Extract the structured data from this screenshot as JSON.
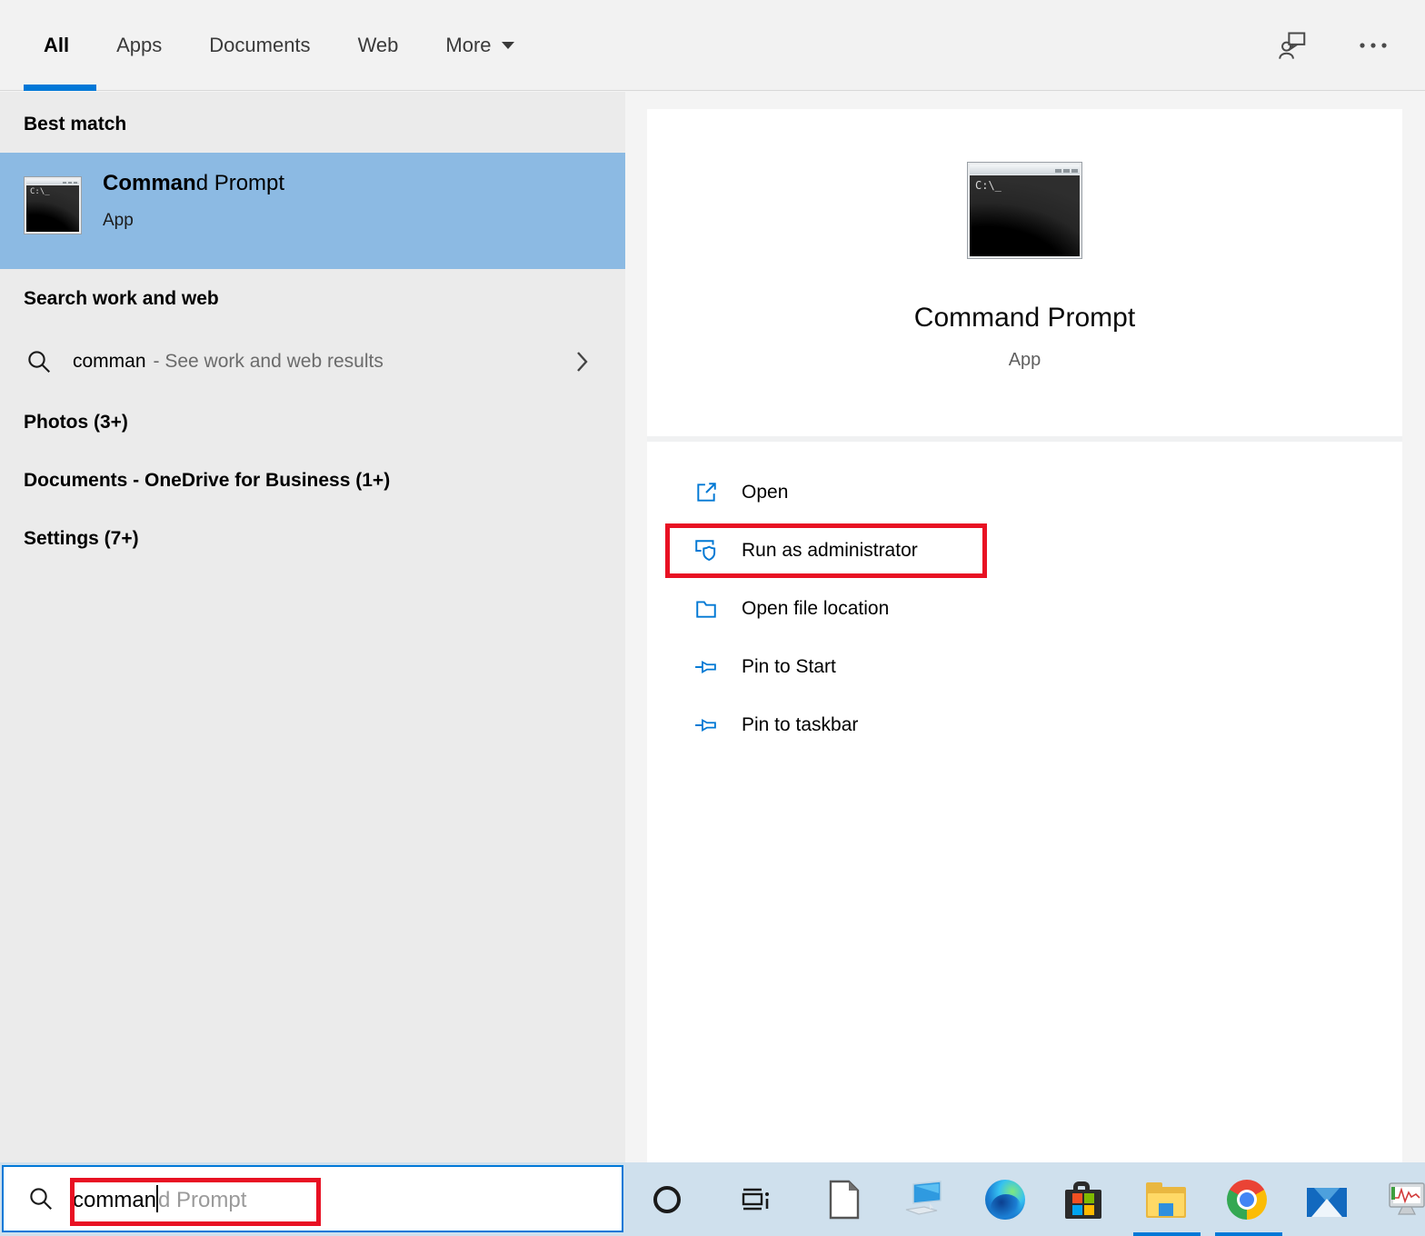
{
  "header": {
    "tabs": [
      {
        "label": "All",
        "active": true
      },
      {
        "label": "Apps",
        "active": false
      },
      {
        "label": "Documents",
        "active": false
      },
      {
        "label": "Web",
        "active": false
      },
      {
        "label": "More",
        "active": false,
        "has_caret": true
      }
    ],
    "icons": [
      "feedback-person-chat-icon",
      "ellipsis-icon"
    ]
  },
  "left_panel": {
    "best_match_heading": "Best match",
    "best_match": {
      "title_bold": "Comman",
      "title_rest": "d Prompt",
      "subtitle": "App"
    },
    "search_heading": "Search work and web",
    "web_suggestion": {
      "query": "comman",
      "hint": "- See work and web results"
    },
    "categories": [
      "Photos (3+)",
      "Documents - OneDrive for Business (1+)",
      "Settings (7+)"
    ]
  },
  "right_panel": {
    "app_title": "Command Prompt",
    "app_subtitle": "App",
    "icon_text": "C:\\_",
    "actions": [
      {
        "label": "Open",
        "icon": "open-icon",
        "highlighted": false
      },
      {
        "label": "Run as administrator",
        "icon": "run-as-admin-icon",
        "highlighted": true
      },
      {
        "label": "Open file location",
        "icon": "open-file-location-icon",
        "highlighted": false
      },
      {
        "label": "Pin to Start",
        "icon": "pin-icon",
        "highlighted": false
      },
      {
        "label": "Pin to taskbar",
        "icon": "pin-icon",
        "highlighted": false
      }
    ]
  },
  "taskbar": {
    "search": {
      "typed": "comman",
      "suggestion": "d Prompt"
    },
    "icons": [
      "cortana",
      "task-view",
      "libreoffice",
      "this-pc",
      "edge",
      "microsoft-store",
      "file-explorer",
      "chrome",
      "mail",
      "performance-monitor"
    ],
    "running_apps": [
      "file-explorer",
      "chrome"
    ]
  },
  "colors": {
    "accent_blue": "#0078d7",
    "best_match_highlight": "#8cbae3",
    "annotation_red": "#e81123",
    "taskbar_bg": "#cfe0ed"
  }
}
